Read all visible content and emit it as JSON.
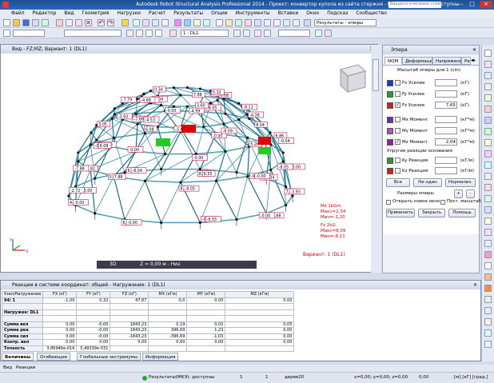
{
  "title": "Autodesk Robot Structural Analysis Professional 2014 - Проект: конвертор купола из сайта стержня - Результаты(МКЭ): доступны",
  "help_placeholder": "Введите ключевое слово/фразу",
  "menu": [
    "Файл",
    "Редактор",
    "Вид",
    "Геометрия",
    "Нагрузки",
    "Расчет",
    "Результаты",
    "Опции",
    "Инструменты",
    "Вставки",
    "Окно",
    "Подсказ",
    "Сообщество"
  ],
  "toolbar": {
    "results_dropdown": "Результаты - эпюры",
    "case_dropdown": "1 : DL1"
  },
  "view": {
    "title": "Вид - FZ;MZ; Вариант: 1 (DL1)",
    "bottom_mode": "3D",
    "bottom_z": "Z = 0,00 м - Низ",
    "legend_mz": "Mz  1kGm",
    "legend_mz_max": "Макс=2,34",
    "legend_mz_min": "Мин=-1,20",
    "legend_fz": "Fz  2kG",
    "legend_fz_max": "Макс=8,09",
    "legend_fz_min": "Мин=-8,11",
    "variant": "Вариант: 1 (DL1)",
    "axis_y": "Y",
    "axis_x": "X",
    "labels": [
      "7.88",
      "7.88",
      "-0.00",
      "6.56",
      "4.80",
      "-0.00",
      "6.84",
      "8.09",
      "0.42",
      "-0.00",
      "-0.25",
      "8.03",
      "5.26",
      "7.82",
      "-0.03",
      "6.08",
      "-0.00",
      "-0.04",
      "6.86",
      "5.26",
      "-0.00",
      "-0.00",
      "-0.00",
      "3.05",
      "-7.88",
      "-4.99",
      "8.04",
      "-4.38",
      "-8.09",
      "-5.60",
      "-4.53",
      "-3.93",
      "-7.79",
      "-8.04",
      "0.08",
      "-8.11",
      "6.08",
      "-8.05",
      "3.60",
      "-0.00",
      "-0.00",
      "-4.68",
      "0.34",
      "7.88",
      "5.32",
      "-3.93",
      "-0.00",
      "-6.55",
      "-0.00",
      "-0.00",
      "-2.72",
      "-8.04",
      "6.55",
      "0.34",
      "-8.05",
      "-0.00",
      "-8.05",
      "7.88",
      "-7.88",
      "6.08"
    ]
  },
  "panel": {
    "title": "Эпюра",
    "tabs": [
      "NQM",
      "Деформация",
      "Напряжение",
      "Ре"
    ],
    "scale_label": "Масштаб эпюры для 1  (cm)",
    "rows": [
      {
        "label": "Fx Усилие",
        "value": "",
        "unit": "(кГ)",
        "checked": false,
        "color": "#1a3cc8"
      },
      {
        "label": "Fy Усилие",
        "value": "",
        "unit": "(кГ)",
        "checked": false,
        "color": "#2d9a2d"
      },
      {
        "label": "Fz Усилие",
        "value": "7,65",
        "unit": "(кГ)",
        "checked": true,
        "color": "#d81b1b"
      },
      {
        "label": "Mx Момент",
        "value": "",
        "unit": "(кГ*м)",
        "checked": false,
        "color": "#6a2ca0"
      },
      {
        "label": "My Момент",
        "value": "",
        "unit": "(кГ*м)",
        "checked": false,
        "color": "#b64ec8"
      },
      {
        "label": "Mz Момент",
        "value": "2,04",
        "unit": "(кГ*м)",
        "checked": true,
        "color": "#9a1aa8"
      }
    ],
    "reactions_label": "Упругие реакции основания",
    "reactions": [
      {
        "label": "Ky Реакция",
        "unit": "(кГ/м)",
        "color": "#2d9a2d"
      },
      {
        "label": "Kz Реакция",
        "unit": "(кГ/м)",
        "color": "#d81b1b"
      }
    ],
    "btn_all": "Все",
    "btn_none": "Ни один",
    "btn_normal": "Нормализ.",
    "sizes_label": "Размеры эпюры",
    "plus": "+",
    "minus": "-",
    "open_new": "Открыть новое окно",
    "const_scale": "Пост. масштаб",
    "btn_apply": "Применить",
    "btn_close": "Закрыть",
    "btn_help": "Помощь"
  },
  "table": {
    "title": "Реакции в системе координат: общей - Нагружение: 1 (DL1)",
    "columns": [
      "Узел/Нагружение",
      "FX (кГ)",
      "FY (кГ)",
      "FZ (кГ)",
      "MX (кГм)",
      "MY (кГм)",
      "MZ (кГм)"
    ],
    "rows": [
      [
        "94/ 1",
        "-1,00",
        "0,32",
        "47,87",
        "0,0",
        "0,00",
        "0,00"
      ],
      [
        "",
        "",
        "",
        "",
        "",
        "",
        ""
      ],
      [
        "Нагружен: DL1",
        "",
        "",
        "",
        "",
        "",
        ""
      ],
      [
        "",
        "",
        "",
        "",
        "",
        "",
        ""
      ],
      [
        "Сумма вел",
        "0,00",
        "-0,00",
        "1843,23",
        "0,19",
        "0,02",
        "0,05"
      ],
      [
        "Сумма реа",
        "0,00",
        "-0,00",
        "1843,23",
        "396,69",
        "1,23",
        "0,00"
      ],
      [
        "Сумма сил",
        "0,00",
        "-0,00",
        "-1843,23",
        "-396,69",
        "-1,03",
        "0,00"
      ],
      [
        "Контр. вел",
        "0,00",
        "0,00",
        "0,00",
        "0,00",
        "0,00",
        "0,00"
      ],
      [
        "Точность",
        "3,86946e-016",
        "5,49339e-031",
        "",
        "",
        "",
        ""
      ]
    ],
    "tabs": [
      "Величины",
      "Огибающее",
      "Глобальные экстремумы",
      "Информация"
    ]
  },
  "bottom_tabs": [
    "Вид",
    "Реакции"
  ],
  "status": {
    "results": "Результаты(МКЭ): доступны",
    "n1": "1",
    "n2": "1",
    "sect": "дерев20",
    "coords": "x=0,00; y=0,00; z=0,00",
    "zero": "0,00",
    "units": "[м] [кГ] [град.]"
  }
}
